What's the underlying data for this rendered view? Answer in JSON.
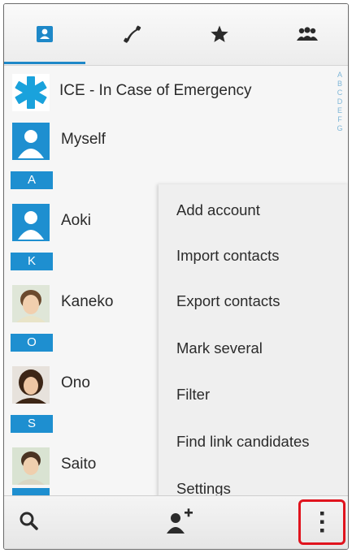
{
  "tabs": [
    {
      "icon": "contacts-card-icon",
      "active": true
    },
    {
      "icon": "phone-handset-icon",
      "active": false
    },
    {
      "icon": "star-icon",
      "active": false
    },
    {
      "icon": "group-people-icon",
      "active": false
    }
  ],
  "alpha_index": [
    "A",
    "B",
    "C",
    "D",
    "E",
    "F",
    "G"
  ],
  "contacts": {
    "ice": {
      "name": "ICE - In Case of Emergency"
    },
    "myself": {
      "name": "Myself"
    },
    "section_a": "A",
    "aoki": {
      "name": "Aoki"
    },
    "section_k": "K",
    "kaneko": {
      "name": "Kaneko"
    },
    "section_o": "O",
    "ono": {
      "name": "Ono"
    },
    "section_s": "S",
    "saito": {
      "name": "Saito"
    }
  },
  "menu": {
    "items": [
      "Add account",
      "Import contacts",
      "Export contacts",
      "Mark several",
      "Filter",
      "Find link candidates",
      "Settings"
    ]
  },
  "bottom_bar": {
    "search_icon": "search-icon",
    "add_contact_icon": "add-contact-icon",
    "more_icon": "more-vertical-icon",
    "highlight_color": "#e0141e"
  },
  "colors": {
    "accent": "#1e88c8",
    "section_badge": "#1e8fd0"
  }
}
